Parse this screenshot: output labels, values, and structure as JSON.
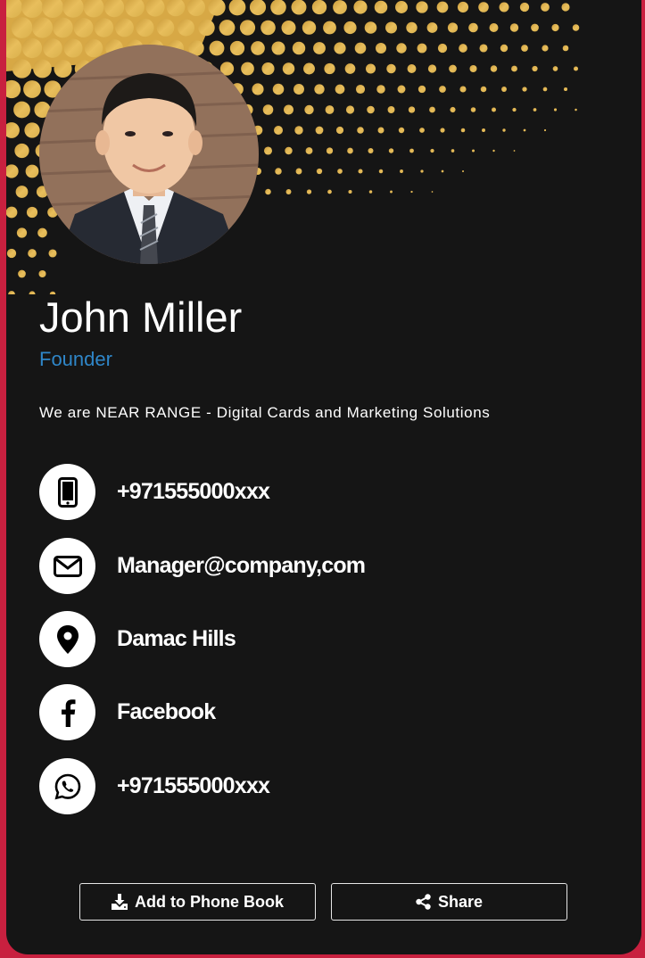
{
  "profile": {
    "name": "John Miller",
    "title": "Founder",
    "tagline": "We are NEAR RANGE - Digital Cards and Marketing Solutions"
  },
  "contacts": [
    {
      "icon": "mobile-phone-icon",
      "label": "+971555000xxx"
    },
    {
      "icon": "envelope-icon",
      "label": "Manager@company,com"
    },
    {
      "icon": "map-pin-icon",
      "label": "Damac Hills"
    },
    {
      "icon": "facebook-icon",
      "label": "Facebook"
    },
    {
      "icon": "whatsapp-icon",
      "label": "+971555000xxx"
    }
  ],
  "actions": {
    "add_to_phonebook": "Add to Phone Book",
    "share": "Share"
  },
  "colors": {
    "page_border": "#c8203f",
    "card_background": "#151515",
    "accent_gold": "#e0b04e",
    "title_blue": "#2f86c8"
  }
}
